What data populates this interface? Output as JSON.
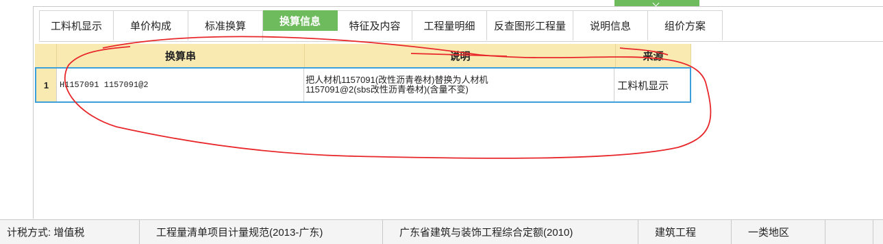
{
  "tabs": [
    {
      "label": "工料机显示"
    },
    {
      "label": "单价构成"
    },
    {
      "label": "标准换算"
    },
    {
      "label": "换算信息",
      "active": true
    },
    {
      "label": "特征及内容"
    },
    {
      "label": "工程量明细"
    },
    {
      "label": "反查图形工程量"
    },
    {
      "label": "说明信息"
    },
    {
      "label": "组价方案"
    }
  ],
  "table": {
    "headers": {
      "conversion": "换算串",
      "description": "说明",
      "source": "来源"
    },
    "rows": [
      {
        "index": "1",
        "conversion": "H1157091 1157091@2",
        "description": "把人材机1157091(改性沥青卷材)替换为人材机\n1157091@2(sbs改性沥青卷材)(含量不变)",
        "source": "工料机显示"
      }
    ]
  },
  "status_bar": {
    "tax": "计税方式: 增值税",
    "spec": "工程量清单项目计量规范(2013-广东)",
    "quota": "广东省建筑与装饰工程综合定额(2010)",
    "discipline": "建筑工程",
    "region": "一类地区"
  },
  "colors": {
    "active_tab": "#6dbb5d",
    "header_bg": "#f9eab2",
    "selection_border": "#3d9fd9",
    "annotation": "#e8262a"
  }
}
